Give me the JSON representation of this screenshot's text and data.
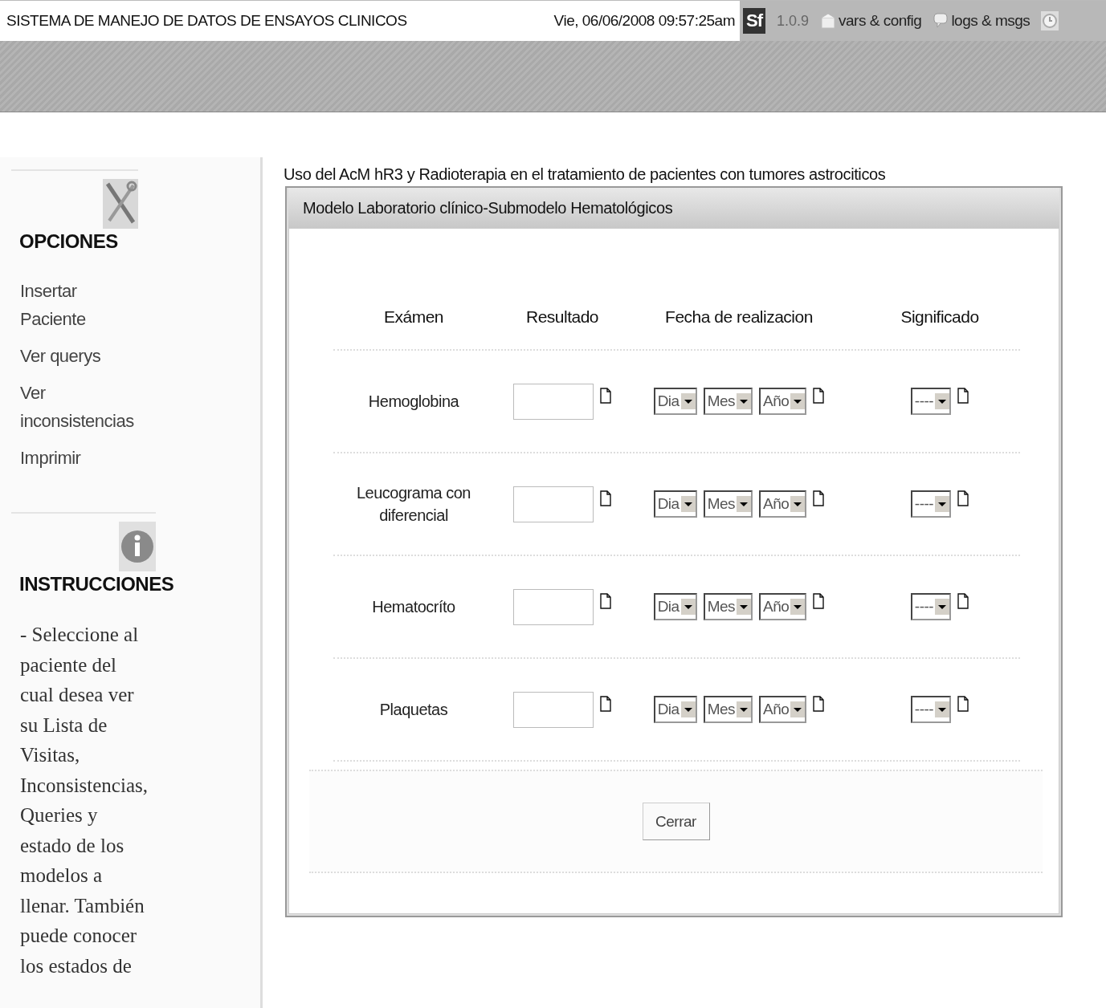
{
  "header": {
    "title": "SISTEMA DE MANEJO DE DATOS DE ENSAYOS CLINICOS",
    "datetime": "Vie, 06/06/2008 09:57:25am",
    "logo": "Sf",
    "version": "1.0.9",
    "links": [
      {
        "kind": "config",
        "label": "vars & config"
      },
      {
        "kind": "logs",
        "label": "logs & msgs"
      }
    ]
  },
  "sidebar": {
    "sections": [
      {
        "kind": "options",
        "title": "OPCIONES",
        "items": [
          "Insertar Paciente",
          "Ver querys",
          "Ver inconsistencias",
          "Imprimir"
        ]
      },
      {
        "kind": "instructions",
        "title": "INSTRUCCIONES",
        "text": "- Seleccione al paciente del cual desea ver su Lista de Visitas, Inconsistencias, Queries y estado de los modelos a llenar. También puede conocer los estados de"
      }
    ]
  },
  "study_title": "Uso del AcM hR3 y Radioterapia en el tratamiento de pacientes con tumores astrociticos",
  "panel": {
    "title": "Modelo Laboratorio clínico-Submodelo Hematológicos",
    "columns": [
      "Exámen",
      "Resultado",
      "Fecha de realizacion",
      "Significado"
    ],
    "rows": [
      {
        "exam": "Hemoglobina",
        "date": [
          "Dia",
          "Mes",
          "Año"
        ],
        "significance": "----"
      },
      {
        "exam": "Leucograma con diferencial",
        "date": [
          "Dia",
          "Mes",
          "Año"
        ],
        "significance": "----"
      },
      {
        "exam": "Hematocríto",
        "date": [
          "Dia",
          "Mes",
          "Año"
        ],
        "significance": "----"
      },
      {
        "exam": "Plaquetas",
        "date": [
          "Dia",
          "Mes",
          "Año"
        ],
        "significance": "----"
      }
    ],
    "button": "Cerrar"
  }
}
